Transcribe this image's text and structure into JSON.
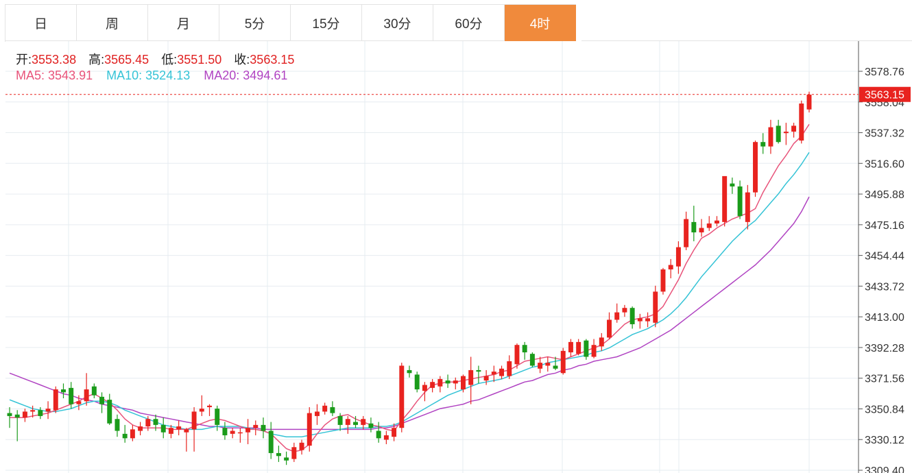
{
  "tabs": [
    {
      "label": "日",
      "active": false
    },
    {
      "label": "周",
      "active": false
    },
    {
      "label": "月",
      "active": false
    },
    {
      "label": "5分",
      "active": false
    },
    {
      "label": "15分",
      "active": false
    },
    {
      "label": "30分",
      "active": false
    },
    {
      "label": "60分",
      "active": false
    },
    {
      "label": "4时",
      "active": true
    }
  ],
  "ohlc": {
    "open_label": "开:",
    "open": "3553.38",
    "high_label": "高:",
    "high": "3565.45",
    "low_label": "低:",
    "low": "3551.50",
    "close_label": "收:",
    "close": "3563.15"
  },
  "ma": {
    "ma5_label": "MA5:",
    "ma5": "3543.91",
    "ma10_label": "MA10:",
    "ma10": "3524.13",
    "ma20_label": "MA20:",
    "ma20": "3494.61"
  },
  "colors": {
    "up": "#e8231f",
    "down": "#1a9b1a",
    "ma5": "#e8537a",
    "ma10": "#34c3d6",
    "ma20": "#b043c2",
    "grid": "#e6ecf0",
    "tab_active": "#f08a3c"
  },
  "chart_data": {
    "type": "candlestick",
    "y_ticks": [
      "3578.76",
      "3558.04",
      "3537.32",
      "3516.60",
      "3495.88",
      "3475.16",
      "3454.44",
      "3433.72",
      "3413.00",
      "3392.28",
      "3371.56",
      "3350.84",
      "3330.12",
      "3309.40"
    ],
    "ylim": [
      3309.4,
      3578.76
    ],
    "last_price": "3563.15",
    "candles": [
      [
        3348,
        3352,
        3338,
        3346
      ],
      [
        3347,
        3350,
        3329,
        3345
      ],
      [
        3345,
        3351,
        3342,
        3349
      ],
      [
        3349,
        3353,
        3345,
        3350
      ],
      [
        3350,
        3352,
        3344,
        3346
      ],
      [
        3349,
        3356,
        3344,
        3351
      ],
      [
        3350,
        3366,
        3348,
        3364
      ],
      [
        3364,
        3368,
        3358,
        3362
      ],
      [
        3365,
        3369,
        3351,
        3354
      ],
      [
        3354,
        3360,
        3350,
        3356
      ],
      [
        3356,
        3375,
        3353,
        3364
      ],
      [
        3366,
        3368,
        3358,
        3360
      ],
      [
        3359,
        3362,
        3348,
        3354
      ],
      [
        3357,
        3361,
        3340,
        3341
      ],
      [
        3344,
        3347,
        3332,
        3336
      ],
      [
        3334,
        3340,
        3328,
        3331
      ],
      [
        3331,
        3340,
        3329,
        3337
      ],
      [
        3336,
        3342,
        3333,
        3339
      ],
      [
        3339,
        3346,
        3336,
        3344
      ],
      [
        3344,
        3347,
        3336,
        3340
      ],
      [
        3340,
        3345,
        3331,
        3335
      ],
      [
        3334,
        3340,
        3331,
        3338
      ],
      [
        3337,
        3343,
        3333,
        3339
      ],
      [
        3335,
        3338,
        3322,
        3337
      ],
      [
        3337,
        3352,
        3322,
        3349
      ],
      [
        3349,
        3360,
        3346,
        3351
      ],
      [
        3352,
        3354,
        3346,
        3353
      ],
      [
        3351,
        3353,
        3336,
        3340
      ],
      [
        3338,
        3342,
        3330,
        3333
      ],
      [
        3334,
        3338,
        3331,
        3336
      ],
      [
        3335,
        3338,
        3328,
        3335
      ],
      [
        3335,
        3344,
        3327,
        3338
      ],
      [
        3338,
        3343,
        3333,
        3340
      ],
      [
        3340,
        3345,
        3331,
        3336
      ],
      [
        3336,
        3342,
        3317,
        3321
      ],
      [
        3321,
        3326,
        3315,
        3319
      ],
      [
        3318,
        3322,
        3313,
        3316
      ],
      [
        3317,
        3328,
        3315,
        3325
      ],
      [
        3323,
        3330,
        3320,
        3328
      ],
      [
        3326,
        3352,
        3322,
        3348
      ],
      [
        3346,
        3354,
        3340,
        3349
      ],
      [
        3349,
        3355,
        3347,
        3353
      ],
      [
        3352,
        3356,
        3346,
        3348
      ],
      [
        3346,
        3348,
        3336,
        3340
      ],
      [
        3340,
        3346,
        3334,
        3344
      ],
      [
        3342,
        3346,
        3338,
        3340
      ],
      [
        3340,
        3346,
        3337,
        3344
      ],
      [
        3341,
        3345,
        3335,
        3338
      ],
      [
        3336,
        3342,
        3328,
        3331
      ],
      [
        3330,
        3336,
        3327,
        3333
      ],
      [
        3332,
        3341,
        3329,
        3338
      ],
      [
        3338,
        3382,
        3335,
        3380
      ],
      [
        3377,
        3380,
        3372,
        3375
      ],
      [
        3374,
        3376,
        3362,
        3364
      ],
      [
        3363,
        3369,
        3356,
        3367
      ],
      [
        3365,
        3371,
        3362,
        3369
      ],
      [
        3366,
        3373,
        3362,
        3371
      ],
      [
        3370,
        3374,
        3365,
        3368
      ],
      [
        3368,
        3372,
        3364,
        3370
      ],
      [
        3364,
        3374,
        3362,
        3373
      ],
      [
        3367,
        3386,
        3354,
        3377
      ],
      [
        3377,
        3380,
        3368,
        3376
      ],
      [
        3370,
        3377,
        3367,
        3373
      ],
      [
        3374,
        3380,
        3369,
        3376
      ],
      [
        3373,
        3380,
        3371,
        3378
      ],
      [
        3373,
        3387,
        3371,
        3383
      ],
      [
        3381,
        3395,
        3378,
        3394
      ],
      [
        3394,
        3396,
        3384,
        3389
      ],
      [
        3388,
        3389,
        3379,
        3380
      ],
      [
        3378,
        3386,
        3375,
        3382
      ],
      [
        3380,
        3386,
        3376,
        3382
      ],
      [
        3380,
        3386,
        3377,
        3378
      ],
      [
        3375,
        3392,
        3374,
        3390
      ],
      [
        3389,
        3398,
        3386,
        3396
      ],
      [
        3388,
        3398,
        3387,
        3396
      ],
      [
        3397,
        3398,
        3384,
        3386
      ],
      [
        3386,
        3398,
        3385,
        3394
      ],
      [
        3393,
        3402,
        3390,
        3399
      ],
      [
        3399,
        3416,
        3398,
        3411
      ],
      [
        3411,
        3422,
        3409,
        3416
      ],
      [
        3416,
        3421,
        3413,
        3419
      ],
      [
        3419,
        3420,
        3405,
        3408
      ],
      [
        3410,
        3415,
        3405,
        3412
      ],
      [
        3410,
        3416,
        3406,
        3412
      ],
      [
        3409,
        3434,
        3406,
        3430
      ],
      [
        3430,
        3446,
        3428,
        3445
      ],
      [
        3445,
        3452,
        3439,
        3448
      ],
      [
        3447,
        3464,
        3442,
        3460
      ],
      [
        3460,
        3484,
        3458,
        3479
      ],
      [
        3477,
        3488,
        3464,
        3470
      ],
      [
        3470,
        3479,
        3467,
        3473
      ],
      [
        3473,
        3481,
        3471,
        3476
      ],
      [
        3476,
        3481,
        3474,
        3478
      ],
      [
        3477,
        3493,
        3474,
        3508
      ],
      [
        3503,
        3507,
        3496,
        3501
      ],
      [
        3501,
        3505,
        3479,
        3481
      ],
      [
        3477,
        3502,
        3472,
        3497
      ],
      [
        3497,
        3532,
        3494,
        3531
      ],
      [
        3531,
        3537,
        3523,
        3528
      ],
      [
        3528,
        3546,
        3523,
        3541
      ],
      [
        3542,
        3546,
        3530,
        3531
      ],
      [
        3537,
        3544,
        3529,
        3538
      ],
      [
        3538,
        3544,
        3534,
        3542
      ],
      [
        3532,
        3559,
        3530,
        3557
      ],
      [
        3553,
        3565,
        3551,
        3563
      ]
    ],
    "ma5": [
      3345,
      3345,
      3345,
      3346,
      3347,
      3348,
      3350,
      3352,
      3354,
      3356,
      3359,
      3361,
      3358,
      3355,
      3350,
      3344,
      3340,
      3338,
      3338,
      3338,
      3338,
      3337,
      3337,
      3337,
      3339,
      3341,
      3343,
      3344,
      3343,
      3341,
      3339,
      3337,
      3337,
      3336,
      3334,
      3329,
      3324,
      3322,
      3323,
      3327,
      3334,
      3340,
      3344,
      3346,
      3347,
      3344,
      3342,
      3340,
      3339,
      3337,
      3336,
      3343,
      3349,
      3356,
      3362,
      3367,
      3368,
      3369,
      3369,
      3370,
      3371,
      3372,
      3373,
      3374,
      3376,
      3377,
      3380,
      3383,
      3384,
      3385,
      3386,
      3385,
      3384,
      3386,
      3388,
      3390,
      3392,
      3394,
      3398,
      3403,
      3408,
      3411,
      3412,
      3413,
      3415,
      3420,
      3429,
      3438,
      3449,
      3458,
      3466,
      3469,
      3473,
      3476,
      3479,
      3481,
      3483,
      3486,
      3497,
      3506,
      3515,
      3522,
      3530,
      3535,
      3543
    ],
    "ma10": [
      3357,
      3355,
      3353,
      3351,
      3350,
      3349,
      3349,
      3350,
      3351,
      3353,
      3355,
      3356,
      3356,
      3355,
      3353,
      3350,
      3348,
      3346,
      3344,
      3342,
      3340,
      3339,
      3338,
      3337,
      3337,
      3337,
      3338,
      3339,
      3339,
      3339,
      3339,
      3338,
      3337,
      3336,
      3334,
      3333,
      3332,
      3332,
      3332,
      3333,
      3334,
      3335,
      3336,
      3337,
      3338,
      3338,
      3338,
      3338,
      3339,
      3339,
      3340,
      3342,
      3345,
      3348,
      3351,
      3354,
      3357,
      3360,
      3362,
      3364,
      3366,
      3368,
      3369,
      3370,
      3371,
      3373,
      3375,
      3377,
      3379,
      3380,
      3382,
      3383,
      3384,
      3385,
      3386,
      3387,
      3389,
      3390,
      3392,
      3395,
      3398,
      3401,
      3403,
      3405,
      3408,
      3411,
      3415,
      3420,
      3426,
      3433,
      3440,
      3446,
      3452,
      3458,
      3464,
      3469,
      3474,
      3478,
      3484,
      3490,
      3496,
      3503,
      3509,
      3516,
      3524
    ],
    "ma20": [
      3375,
      3373,
      3371,
      3369,
      3367,
      3365,
      3363,
      3361,
      3360,
      3358,
      3357,
      3356,
      3354,
      3353,
      3352,
      3351,
      3350,
      3348,
      3347,
      3346,
      3345,
      3344,
      3343,
      3342,
      3341,
      3340,
      3339,
      3339,
      3338,
      3338,
      3338,
      3338,
      3338,
      3337,
      3337,
      3337,
      3337,
      3337,
      3337,
      3337,
      3337,
      3337,
      3337,
      3337,
      3337,
      3337,
      3337,
      3337,
      3338,
      3338,
      3339,
      3341,
      3343,
      3345,
      3347,
      3349,
      3351,
      3352,
      3353,
      3354,
      3356,
      3357,
      3359,
      3361,
      3363,
      3365,
      3367,
      3369,
      3370,
      3372,
      3374,
      3375,
      3377,
      3378,
      3380,
      3381,
      3383,
      3384,
      3385,
      3386,
      3388,
      3390,
      3392,
      3395,
      3398,
      3401,
      3404,
      3408,
      3412,
      3416,
      3420,
      3424,
      3428,
      3432,
      3436,
      3440,
      3444,
      3448,
      3453,
      3458,
      3464,
      3470,
      3476,
      3484,
      3494
    ]
  }
}
